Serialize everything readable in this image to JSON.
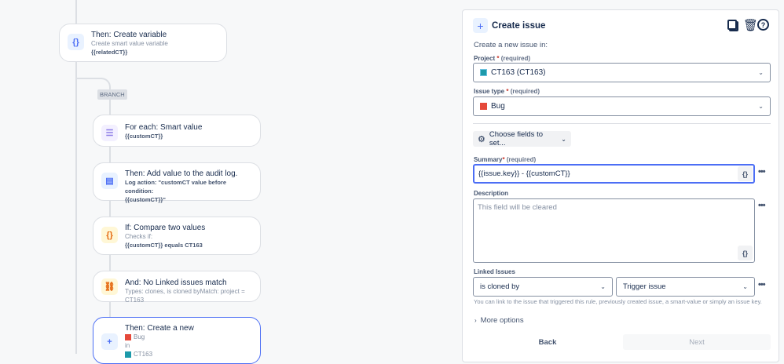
{
  "flow": {
    "create_variable": {
      "title": "Then: Create variable",
      "subtitle": "Create smart value variable",
      "value": "{{relatedCT}}"
    },
    "branch_label": "BRANCH",
    "for_each": {
      "title": "For each: Smart value",
      "value": "{{customCT}}"
    },
    "audit_log": {
      "title": "Then: Add value to the audit log.",
      "line1": "Log action: \"customCT value before condition:",
      "line2": "{{customCT}}\""
    },
    "compare": {
      "title": "If: Compare two values",
      "subtitle": "Checks if:",
      "value": "{{customCT}} equals CT163"
    },
    "linked": {
      "title": "And: No Linked issues match",
      "subtitle": "Types: clones, is cloned byMatch: project = CT163"
    },
    "create_new": {
      "title": "Then: Create a new",
      "type": "Bug",
      "in": "in",
      "project": "CT163"
    }
  },
  "panel": {
    "title": "Create issue",
    "intro": "Create a new issue in:",
    "project_label": "Project",
    "required_mark": "*",
    "required_text": "(required)",
    "project_value": "CT163 (CT163)",
    "issue_type_label": "Issue type",
    "issue_type_value": "Bug",
    "choose_fields": "Choose fields to set...",
    "summary_label": "Summary",
    "summary_value": "{{issue.key}} - {{customCT}}",
    "description_label": "Description",
    "description_placeholder": "This field will be cleared",
    "linked_label": "Linked Issues",
    "link_type": "is cloned by",
    "link_target": "Trigger issue",
    "linked_help": "You can link to the issue that triggered this rule, previously created issue, a smart-value or simply an issue key.",
    "more_options": "More options",
    "back": "Back",
    "next": "Next",
    "smart_value_btn": "{}",
    "more_btn": "•••"
  }
}
